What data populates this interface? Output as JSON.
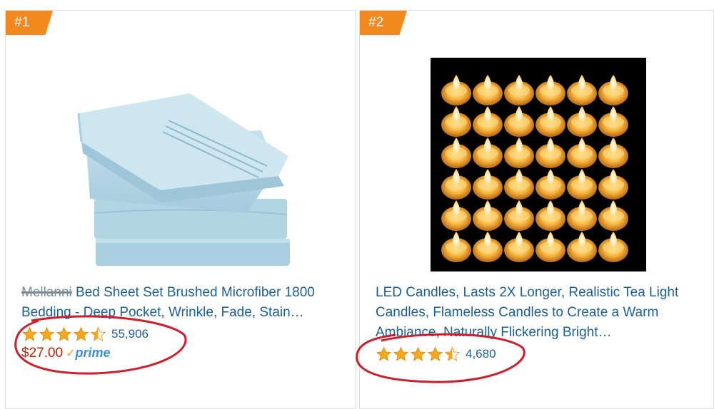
{
  "products": [
    {
      "rank": "#1",
      "brand": "Mellanni",
      "title": "Bed Sheet Set Brushed Microfiber 1800 Bedding - Deep Pocket, Wrinkle, Fade, Stain…",
      "rating_value": 4.5,
      "review_count": "55,906",
      "price": "$27.00",
      "prime_label": "prime",
      "image_icon": "bed-sheet-image"
    },
    {
      "rank": "#2",
      "title": "LED Candles, Lasts 2X Longer, Realistic Tea Light Candles, Flameless Candles to Create a Warm Ambiance, Naturally Flickering Bright…",
      "rating_value": 4.5,
      "review_count": "4,680",
      "image_icon": "led-candles-image"
    }
  ],
  "colors": {
    "badge": "#f3891e",
    "link": "#1a5e9a",
    "price": "#b12704",
    "star": "#f7a71d",
    "prime": "#3b8ed5",
    "annotation": "#cc1e2b"
  }
}
